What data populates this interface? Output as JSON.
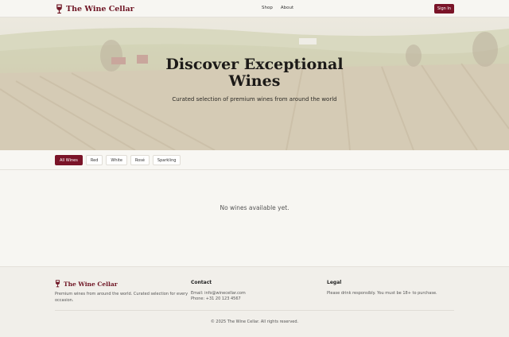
{
  "header": {
    "brand": "The Wine Cellar",
    "nav": [
      "Shop",
      "About"
    ],
    "signin": "Sign In"
  },
  "hero": {
    "title_line1": "Discover Exceptional",
    "title_line2": "Wines",
    "subtitle": "Curated selection of premium wines from around the world"
  },
  "filters": {
    "chips": [
      "All Wines",
      "Red",
      "White",
      "Rosé",
      "Sparkling"
    ],
    "active": "All Wines"
  },
  "main": {
    "empty_text": "No wines available yet."
  },
  "footer": {
    "brand": "The Wine Cellar",
    "description": "Premium wines from around the world. Curated selection for every occasion.",
    "contact_heading": "Contact",
    "email": "Email: info@winecellar.com",
    "phone": "Phone: +31 20 123 4567",
    "legal_heading": "Legal",
    "legal_text": "Please drink responsibly. You must be 18+ to purchase.",
    "copyright": "© 2025 The Wine Cellar. All rights reserved."
  },
  "colors": {
    "accent": "#7a1428",
    "background": "#f7f6f2",
    "footer_bg": "#f1efea"
  },
  "icons": {
    "logo": "wine-glass-icon"
  }
}
